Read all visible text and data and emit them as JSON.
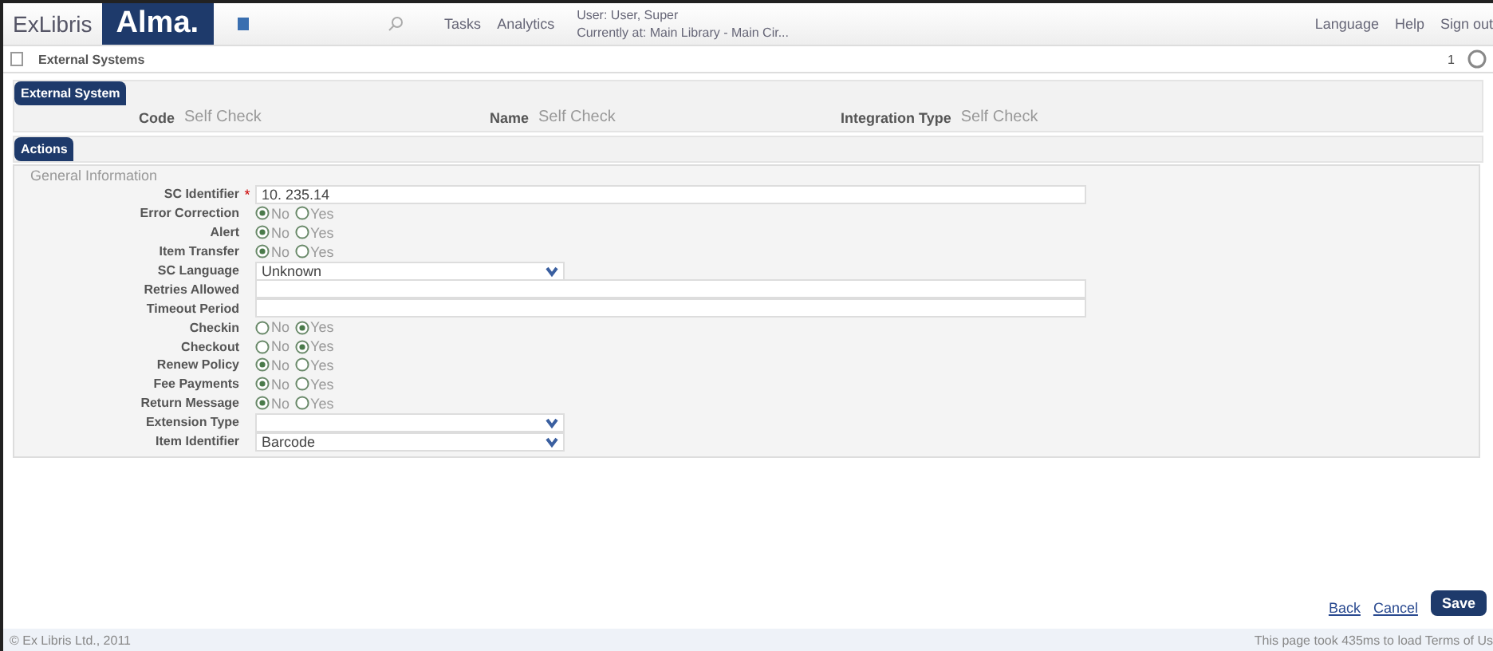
{
  "header": {
    "brand": "ExLibris",
    "product": "Alma.",
    "nav": [
      "Tasks",
      "Analytics"
    ],
    "user": "User: User, Super",
    "location": "Currently at: Main Library - Main Cir...",
    "links": [
      "Language",
      "Help",
      "Sign out"
    ]
  },
  "breadcrumb": {
    "title": "External Systems",
    "page": "1"
  },
  "summary": {
    "heading": "External System",
    "fields": [
      {
        "label": "Code",
        "value": "Self Check"
      },
      {
        "label": "Name",
        "value": "Self Check"
      },
      {
        "label": "Integration Type",
        "value": "Self Check"
      }
    ]
  },
  "actions": {
    "label": "Actions"
  },
  "form": {
    "legend": "General Information",
    "fields": [
      {
        "kind": "text",
        "label": "SC Identifier",
        "required_mark": "*",
        "value": "10. 235.14"
      },
      {
        "kind": "radio",
        "label": "Error Correction",
        "options": [
          {
            "label": "No",
            "selected": true
          },
          {
            "label": "Yes",
            "selected": false
          }
        ]
      },
      {
        "kind": "radio",
        "label": "Alert",
        "options": [
          {
            "label": "No",
            "selected": true
          },
          {
            "label": "Yes",
            "selected": false
          }
        ]
      },
      {
        "kind": "radio",
        "label": "Item Transfer",
        "options": [
          {
            "label": "No",
            "selected": true
          },
          {
            "label": "Yes",
            "selected": false
          }
        ]
      },
      {
        "kind": "select",
        "label": "SC Language",
        "value": "Unknown"
      },
      {
        "kind": "text",
        "label": "Retries Allowed"
      },
      {
        "kind": "text",
        "label": "Timeout Period"
      },
      {
        "kind": "radio",
        "label": "Checkin",
        "options": [
          {
            "label": "No",
            "selected": false
          },
          {
            "label": "Yes",
            "selected": true
          }
        ]
      },
      {
        "kind": "radio",
        "label": "Checkout",
        "options": [
          {
            "label": "No",
            "selected": false
          },
          {
            "label": "Yes",
            "selected": true
          }
        ]
      },
      {
        "kind": "radio",
        "label": "Renew Policy",
        "options": [
          {
            "label": "No",
            "selected": true
          },
          {
            "label": "Yes",
            "selected": false
          }
        ]
      },
      {
        "kind": "radio",
        "label": "Fee Payments",
        "options": [
          {
            "label": "No",
            "selected": true
          },
          {
            "label": "Yes",
            "selected": false
          }
        ]
      },
      {
        "kind": "radio",
        "label": "Return Message",
        "options": [
          {
            "label": "No",
            "selected": true
          },
          {
            "label": "Yes",
            "selected": false
          }
        ]
      },
      {
        "kind": "select",
        "label": "Extension Type"
      },
      {
        "kind": "select",
        "label": "Item Identifier",
        "value": "Barcode"
      }
    ]
  },
  "buttons": [
    {
      "kind": "link",
      "label": "Back"
    },
    {
      "kind": "link",
      "label": "Cancel"
    },
    {
      "kind": "primary",
      "label": "Save"
    }
  ],
  "footer": {
    "copyright": "© Ex Libris Ltd., 2011",
    "load": "This page took 435ms to load",
    "terms": "Terms of Us"
  }
}
